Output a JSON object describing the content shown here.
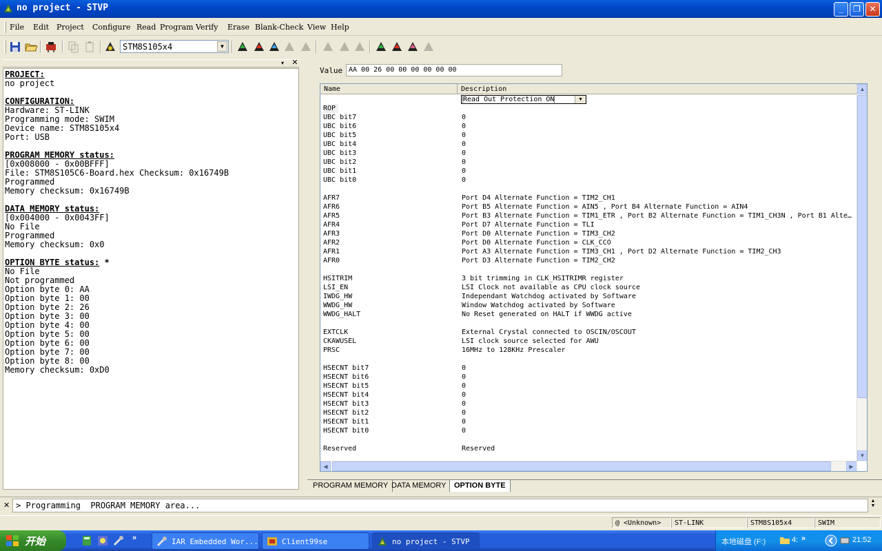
{
  "window": {
    "title": "no project - STVP"
  },
  "menu": [
    "File",
    "Edit",
    "Project",
    "Configure",
    "Read",
    "Program",
    "Verify",
    "Erase",
    "Blank-Check",
    "View",
    "Help"
  ],
  "toolbar": {
    "device": "STM8S105x4"
  },
  "left_panel": {
    "sections": [
      {
        "heading": "PROJECT:",
        "lines": [
          "no project"
        ]
      },
      {
        "heading": "CONFIGURATION:",
        "lines": [
          "Hardware: ST-LINK",
          "Programming mode: SWIM",
          "Device name: STM8S105x4",
          "Port: USB"
        ]
      },
      {
        "heading": "PROGRAM MEMORY status:",
        "lines": [
          "[0x008000 - 0x00BFFF]",
          "File: STM8S105C6-Board.hex Checksum: 0x16749B",
          "Programmed",
          "Memory checksum: 0x16749B"
        ]
      },
      {
        "heading": "DATA MEMORY status:",
        "lines": [
          "[0x004000 - 0x0043FF]",
          "No File",
          "Programmed",
          "Memory checksum: 0x0"
        ]
      },
      {
        "heading": "OPTION BYTE status:",
        "suffix": " *",
        "lines": [
          "No File",
          "Not programmed",
          "Option byte 0: AA",
          "Option byte 1: 00",
          "Option byte 2: 26",
          "Option byte 3: 00",
          "Option byte 4: 00",
          "Option byte 5: 00",
          "Option byte 6: 00",
          "Option byte 7: 00",
          "Option byte 8: 00",
          "Memory checksum: 0xD0"
        ]
      }
    ]
  },
  "option_byte": {
    "value_label": "Value",
    "value": "AA 00 26 00 00 00 00 00 00",
    "columns": {
      "name": "Name",
      "description": "Description"
    },
    "rop": {
      "name": "ROP",
      "value": "Read Out Protection ON"
    },
    "rows": [
      null,
      {
        "name": "UBC bit7",
        "desc": "0"
      },
      {
        "name": "UBC bit6",
        "desc": "0"
      },
      {
        "name": "UBC bit5",
        "desc": "0"
      },
      {
        "name": "UBC bit4",
        "desc": "0"
      },
      {
        "name": "UBC bit3",
        "desc": "0"
      },
      {
        "name": "UBC bit2",
        "desc": "0"
      },
      {
        "name": "UBC bit1",
        "desc": "0"
      },
      {
        "name": "UBC bit0",
        "desc": "0"
      },
      null,
      {
        "name": "AFR7",
        "desc": "Port D4 Alternate Function = TIM2_CH1"
      },
      {
        "name": "AFR6",
        "desc": "Port B5 Alternate Function = AIN5 , Port B4 Alternate Function = AIN4"
      },
      {
        "name": "AFR5",
        "desc": "Port B3 Alternate Function = TIM1_ETR , Port B2 Alternate Function = TIM1_CH3N , Port B1 Alte..."
      },
      {
        "name": "AFR4",
        "desc": "Port D7 Alternate Function = TLI"
      },
      {
        "name": "AFR3",
        "desc": "Port D0 Alternate Function = TIM3_CH2"
      },
      {
        "name": "AFR2",
        "desc": "Port D0 Alternate Function = CLK_CCO"
      },
      {
        "name": "AFR1",
        "desc": "Port A3 Alternate Function = TIM3_CH1 , Port D2 Alternate Function = TIM2_CH3"
      },
      {
        "name": "AFR0",
        "desc": "Port D3 Alternate Function = TIM2_CH2"
      },
      null,
      {
        "name": "HSITRIM",
        "desc": "3 bit trimming in CLK_HSITRIMR register"
      },
      {
        "name": "LSI_EN",
        "desc": "LSI Clock not available as CPU clock source"
      },
      {
        "name": "IWDG_HW",
        "desc": "Independant Watchdog activated by Software"
      },
      {
        "name": "WWDG_HW",
        "desc": "Window Watchdog activated by Software"
      },
      {
        "name": "WWDG_HALT",
        "desc": "No Reset generated on HALT if WWDG active"
      },
      null,
      {
        "name": "EXTCLK",
        "desc": "External Crystal connected to OSCIN/OSCOUT"
      },
      {
        "name": "CKAWUSEL",
        "desc": "LSI clock source selected for AWU"
      },
      {
        "name": "PRSC",
        "desc": "16MHz to 128KHz Prescaler"
      },
      null,
      {
        "name": "HSECNT bit7",
        "desc": "0"
      },
      {
        "name": "HSECNT bit6",
        "desc": "0"
      },
      {
        "name": "HSECNT bit5",
        "desc": "0"
      },
      {
        "name": "HSECNT bit4",
        "desc": "0"
      },
      {
        "name": "HSECNT bit3",
        "desc": "0"
      },
      {
        "name": "HSECNT bit2",
        "desc": "0"
      },
      {
        "name": "HSECNT bit1",
        "desc": "0"
      },
      {
        "name": "HSECNT bit0",
        "desc": "0"
      },
      null,
      {
        "name": "Reserved",
        "desc": "Reserved"
      }
    ]
  },
  "tabs": [
    "PROGRAM MEMORY",
    "DATA MEMORY",
    "OPTION BYTE"
  ],
  "output": {
    "text": "> Programming  PROGRAM MEMORY area..."
  },
  "status": [
    "@ <Unknown>",
    "ST-LINK",
    "STM8S105x4",
    "SWIM"
  ],
  "taskbar": {
    "start": "开始",
    "tasks": [
      "IAR Embedded Wor...",
      "Client99se",
      "no project - STVP"
    ],
    "tray_label": "本地磁盘 (F:)",
    "tray_num": "4:",
    "clock": "21:52"
  }
}
